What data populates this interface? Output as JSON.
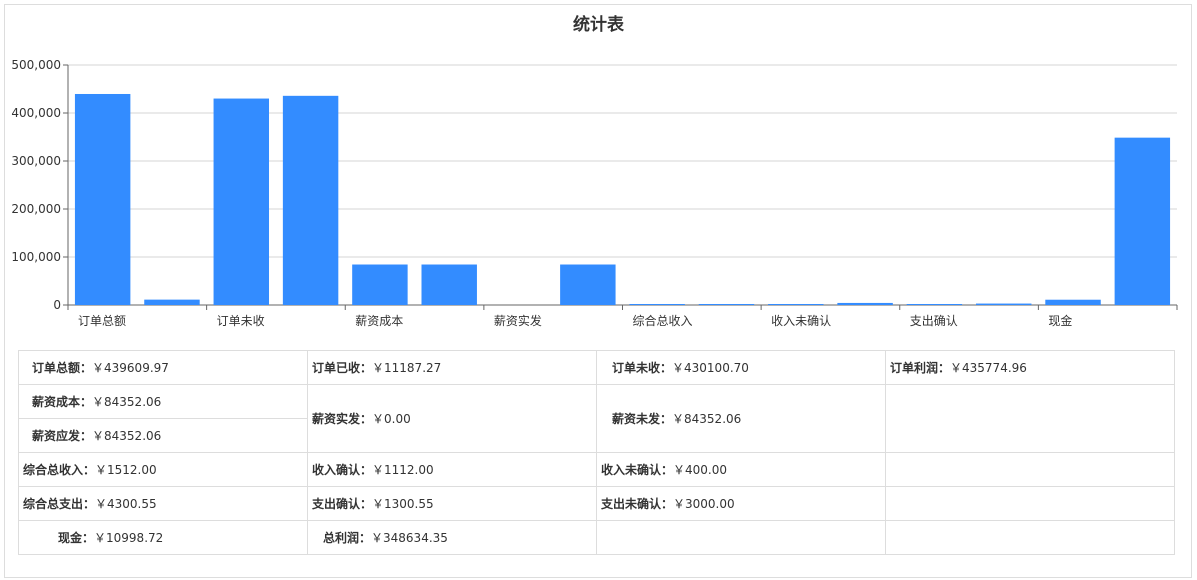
{
  "chart_data": {
    "type": "bar",
    "title": "统计表",
    "ylim": [
      0,
      500000
    ],
    "yticks": [
      "0",
      "100,000",
      "200,000",
      "300,000",
      "400,000",
      "500,000"
    ],
    "ytick_values": [
      0,
      100000,
      200000,
      300000,
      400000,
      500000
    ],
    "category_labels": [
      "订单总额",
      "订单未收",
      "薪资成本",
      "薪资实发",
      "综合总收入",
      "收入未确认",
      "支出确认",
      "现金"
    ],
    "values": [
      439609.97,
      11187.27,
      430100.7,
      435774.96,
      84352.06,
      84352.06,
      0.0,
      84352.06,
      1512.0,
      1112.0,
      400.0,
      4300.55,
      1300.55,
      3000.0,
      10998.72,
      348634.35
    ],
    "bar_color": "#338cff",
    "grid": true,
    "legend": "none"
  },
  "table": {
    "rows": [
      [
        {
          "k": "订单总额：",
          "v": "￥439609.97"
        },
        {
          "k": "订单已收：",
          "v": "￥11187.27"
        },
        {
          "k": "订单未收：",
          "v": "￥430100.70"
        },
        {
          "k": "订单利润：",
          "v": "￥435774.96"
        }
      ],
      [
        {
          "k": "薪资成本：",
          "v": "￥84352.06"
        },
        {
          "k": "薪资实发：",
          "v": "￥0.00"
        },
        {
          "k": "薪资未发：",
          "v": "￥84352.06"
        }
      ],
      [
        {
          "k": "薪资应发：",
          "v": "￥84352.06"
        }
      ],
      [
        {
          "k": "综合总收入：",
          "v": "￥1512.00"
        },
        {
          "k": "收入确认：",
          "v": "￥1112.00"
        },
        {
          "k": "收入未确认：",
          "v": "￥400.00"
        }
      ],
      [
        {
          "k": "综合总支出：",
          "v": "￥4300.55"
        },
        {
          "k": "支出确认：",
          "v": "￥1300.55"
        },
        {
          "k": "支出未确认：",
          "v": "￥3000.00"
        }
      ],
      [
        {
          "k": "现金：",
          "v": "￥10998.72"
        },
        {
          "k": "总利润：",
          "v": "￥348634.35"
        }
      ]
    ]
  }
}
